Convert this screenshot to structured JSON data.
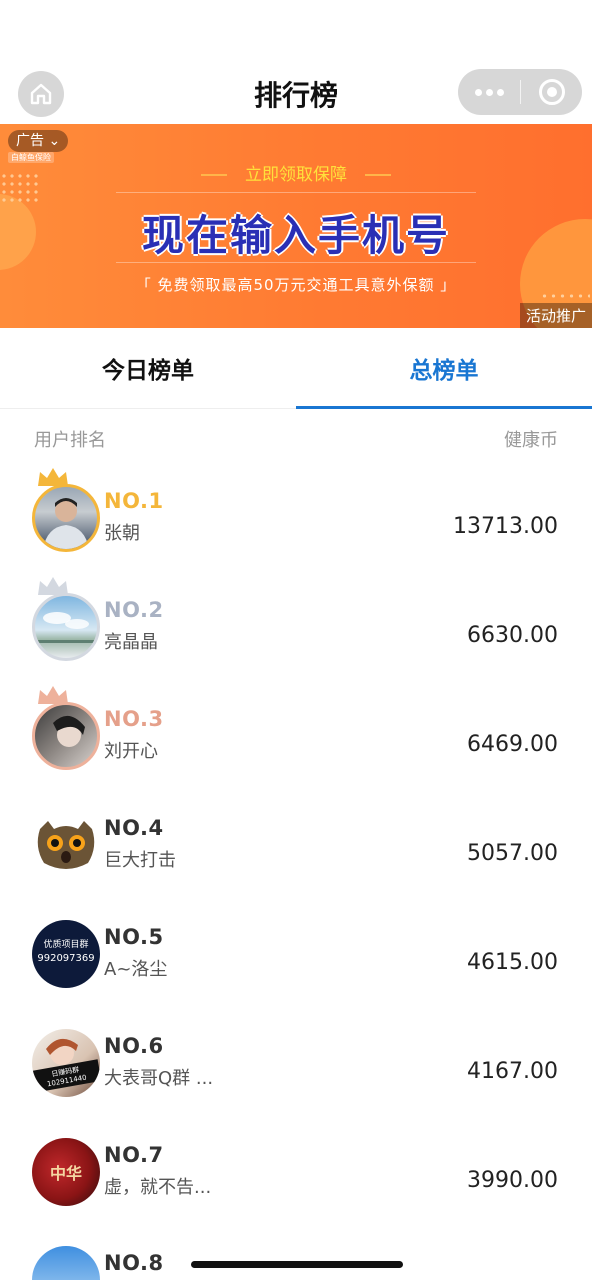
{
  "nav": {
    "title": "排行榜"
  },
  "ad": {
    "badge": "广告",
    "sub_logo": "白鲸鱼保险",
    "top_line": "立即领取保障",
    "headline": "现在输入手机号",
    "desc": "「 免费领取最高50万元交通工具意外保额 」",
    "tag": "活动推广"
  },
  "tabs": [
    {
      "label": "今日榜单",
      "active": false
    },
    {
      "label": "总榜单",
      "active": true
    }
  ],
  "list_header": {
    "left": "用户排名",
    "right": "健康币"
  },
  "rows": [
    {
      "rank": "NO.1",
      "name": "张朝",
      "coins": "13713.00",
      "rank_color": "#f4b63a"
    },
    {
      "rank": "NO.2",
      "name": "亮晶晶",
      "coins": "6630.00",
      "rank_color": "#a9b2c3"
    },
    {
      "rank": "NO.3",
      "name": "刘开心",
      "coins": "6469.00",
      "rank_color": "#e5a08a"
    },
    {
      "rank": "NO.4",
      "name": "巨大打击",
      "coins": "5057.00",
      "rank_color": "#333333"
    },
    {
      "rank": "NO.5",
      "name": "A~洛尘",
      "coins": "4615.00",
      "rank_color": "#333333",
      "avatar_text_1": "优质项目群",
      "avatar_text_2": "992097369"
    },
    {
      "rank": "NO.6",
      "name": "大表哥Q群 ...",
      "coins": "4167.00",
      "rank_color": "#333333",
      "avatar_text": "日赚码群 102911440"
    },
    {
      "rank": "NO.7",
      "name": "虚，就不告...",
      "coins": "3990.00",
      "rank_color": "#333333",
      "avatar_text": "中华"
    },
    {
      "rank": "NO.8",
      "name": "",
      "coins": "",
      "rank_color": "#333333"
    }
  ],
  "colors": {
    "accent": "#1976d2",
    "gold": "#f4b63a",
    "silver": "#a9b2c3",
    "bronze": "#e5a08a",
    "ad_orange": "#ff7a32"
  }
}
